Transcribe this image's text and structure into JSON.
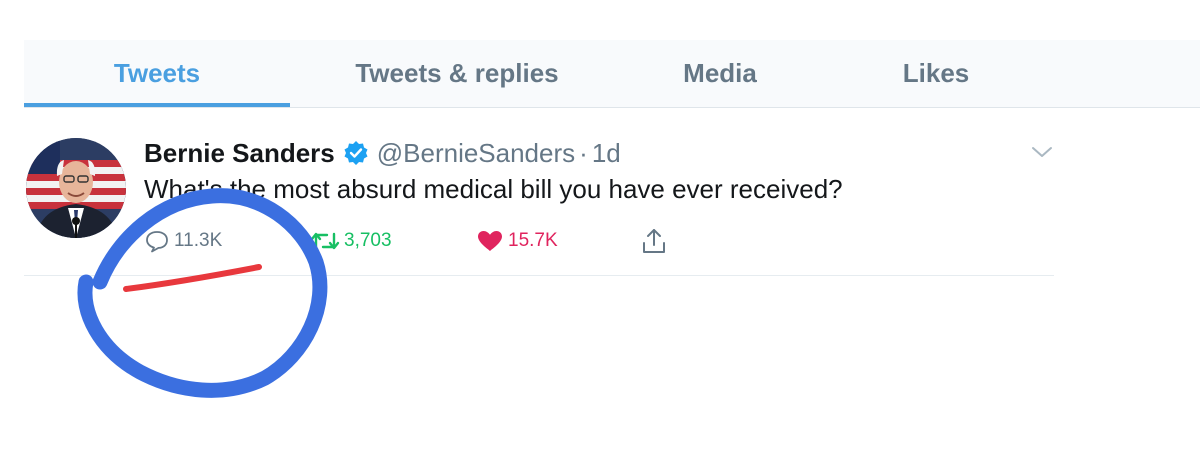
{
  "tabs": [
    {
      "label": "Tweets",
      "active": true
    },
    {
      "label": "Tweets & replies",
      "active": false
    },
    {
      "label": "Media",
      "active": false
    },
    {
      "label": "Likes",
      "active": false
    }
  ],
  "tweet": {
    "author_name": "Bernie Sanders",
    "handle": "@BernieSanders",
    "separator": "·",
    "time": "1d",
    "verified": true,
    "text": "What's the most absurd medical bill you have ever received?",
    "replies": "11.3K",
    "retweets": "3,703",
    "likes": "15.7K",
    "liked": true
  },
  "icons": {
    "reply": "speech-bubble-icon",
    "retweet": "retweet-icon",
    "like": "heart-icon",
    "share": "share-upload-icon",
    "more": "chevron-down-icon",
    "verified": "verified-badge-icon"
  },
  "colors": {
    "accent": "#4a9fe0",
    "retweet": "#17bf63",
    "like": "#e0245e",
    "muted": "#657786",
    "annotation_circle": "#3b6fe0",
    "annotation_underline": "#e8383d"
  }
}
